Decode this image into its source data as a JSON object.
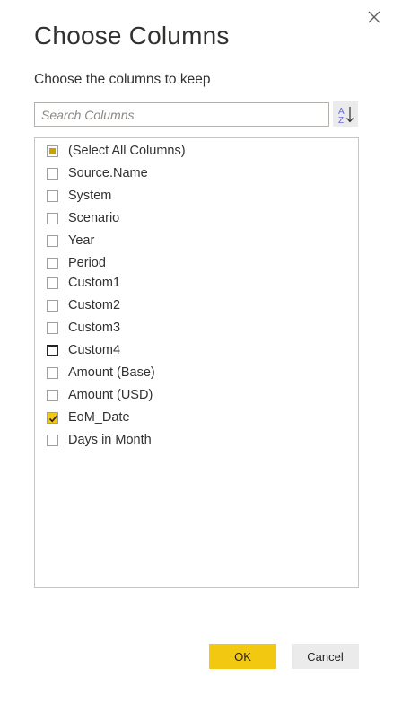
{
  "dialog": {
    "title": "Choose Columns",
    "subtitle": "Choose the columns to keep",
    "close_icon": "close-icon"
  },
  "search": {
    "placeholder": "Search Columns",
    "value": "",
    "sort_icon": "sort-az-icon"
  },
  "columns": {
    "select_all": {
      "label": "(Select All Columns)",
      "state": "indeterminate"
    },
    "items": [
      {
        "label": "Source.Name",
        "state": "unchecked"
      },
      {
        "label": "System",
        "state": "unchecked"
      },
      {
        "label": "Scenario",
        "state": "unchecked"
      },
      {
        "label": "Year",
        "state": "unchecked"
      },
      {
        "label": "Period",
        "state": "unchecked"
      },
      {
        "label": "Custom1",
        "state": "unchecked"
      },
      {
        "label": "Custom2",
        "state": "unchecked"
      },
      {
        "label": "Custom3",
        "state": "unchecked"
      },
      {
        "label": "Custom4",
        "state": "focused"
      },
      {
        "label": "Amount (Base)",
        "state": "unchecked"
      },
      {
        "label": "Amount (USD)",
        "state": "unchecked"
      },
      {
        "label": "EoM_Date",
        "state": "checked"
      },
      {
        "label": "Days in Month",
        "state": "unchecked"
      }
    ]
  },
  "footer": {
    "ok_label": "OK",
    "cancel_label": "Cancel"
  },
  "colors": {
    "accent": "#f2c811",
    "secondary_button": "#ebebeb",
    "border": "#c8c6c4"
  }
}
